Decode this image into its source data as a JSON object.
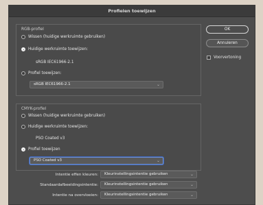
{
  "window": {
    "title": "Profielen toewijzen"
  },
  "rgb": {
    "legend": "RGB-profiel",
    "options": [
      "Wissen (huidige werkruimte gebruiken)",
      "Huidige werkruimte toewijzen:",
      "Profiel toewijzen:"
    ],
    "selected_index": 1,
    "current_profile": "sRGB IEC61966-2.1",
    "select_value": "sRGB IEC61966-2.1"
  },
  "cmyk": {
    "legend": "CMYK-profiel",
    "options": [
      "Wissen (huidige werkruimte gebruiken)",
      "Huidige werkruimte toewijzen:",
      "Profiel toewijzen"
    ],
    "selected_index": 2,
    "current_profile": "PSO Coated v3",
    "select_value": "PSO Coated v3"
  },
  "buttons": {
    "ok": "OK",
    "cancel": "Annuleren"
  },
  "preview": {
    "label": "Voorvertoning",
    "checked": false
  },
  "intents": [
    {
      "label": "Intentie effen kleuren:",
      "value": "Kleurinstellingsintentie gebruiken"
    },
    {
      "label": "Standaardafbeeldingsintentie:",
      "value": "Kleurinstellingsintentie gebruiken"
    },
    {
      "label": "Intentie na overvloeien:",
      "value": "Kleurinstellingsintentie gebruiken"
    }
  ],
  "colors": {
    "dialog_bg": "#4d4d4d",
    "focus_ring": "#3f67b8",
    "page_bg": "#ddd3c6"
  }
}
